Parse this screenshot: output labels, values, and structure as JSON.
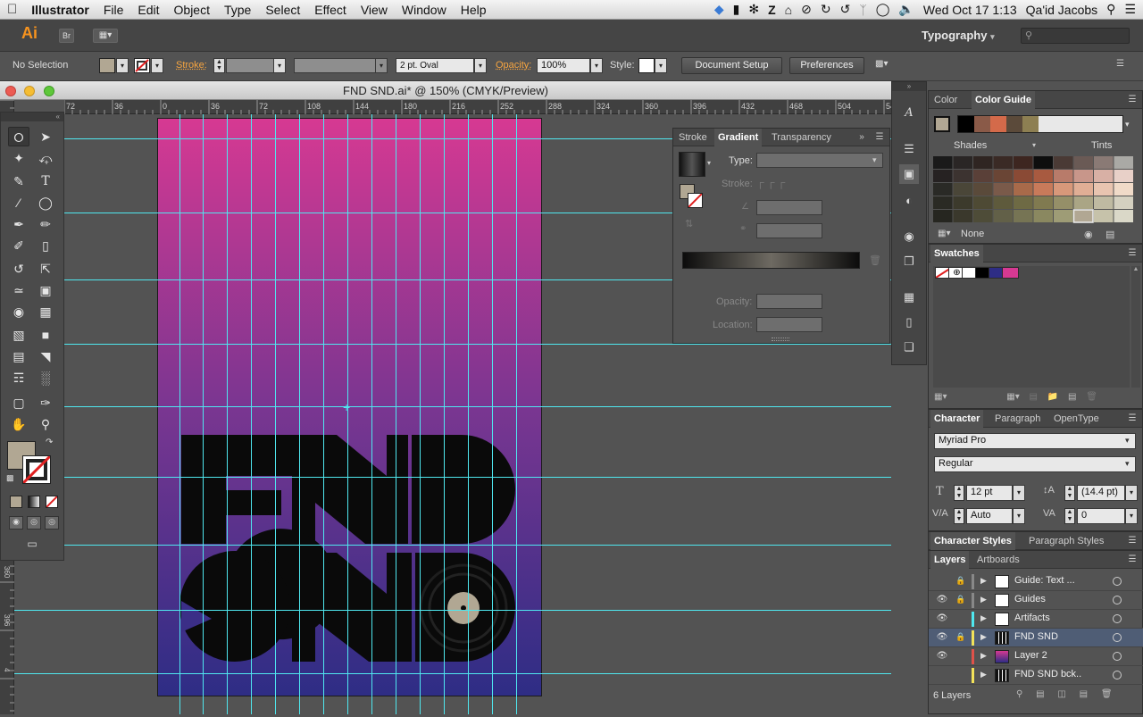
{
  "menubar": {
    "apple": "",
    "app_name": "Illustrator",
    "menus": [
      "File",
      "Edit",
      "Object",
      "Type",
      "Select",
      "Effect",
      "View",
      "Window",
      "Help"
    ],
    "clock": "Wed Oct 17  1:13",
    "user": "Qa'id Jacobs"
  },
  "appbar": {
    "logo": "Ai",
    "bridge": "Br",
    "workspace": "Typography",
    "search_placeholder": ""
  },
  "control": {
    "selection": "No Selection",
    "stroke_label": "Stroke:",
    "brush": "2 pt. Oval",
    "opacity_label": "Opacity:",
    "opacity_value": "100%",
    "style_label": "Style:",
    "doc_setup": "Document Setup",
    "preferences": "Preferences"
  },
  "document": {
    "title": "FND SND.ai* @ 150% (CMYK/Preview)",
    "ruler_h": [
      "72",
      "36",
      "0",
      "36",
      "72",
      "108",
      "144",
      "180",
      "216",
      "252",
      "288",
      "324",
      "360",
      "396",
      "432",
      "468",
      "504",
      "54"
    ],
    "ruler_v": [
      "360",
      "396",
      "4"
    ]
  },
  "gradient_panel": {
    "tabs": [
      "Stroke",
      "Gradient",
      "Transparency"
    ],
    "type_label": "Type:",
    "stroke_label": "Stroke:",
    "opacity_label": "Opacity:",
    "location_label": "Location:"
  },
  "color_panel": {
    "tabs": [
      "Color",
      "Color Guide"
    ],
    "shades": "Shades",
    "tints": "Tints",
    "none": "None",
    "colors": {
      "accent": "#b1a793",
      "orange": "#d46a4a",
      "pink": "#d63992"
    }
  },
  "swatches_panel": {
    "title": "Swatches"
  },
  "character_panel": {
    "tabs": [
      "Character",
      "Paragraph",
      "OpenType"
    ],
    "font": "Myriad Pro",
    "style": "Regular",
    "size": "12 pt",
    "leading": "(14.4 pt)",
    "kerning": "Auto",
    "tracking": "0"
  },
  "styles_tabs": [
    "Character Styles",
    "Paragraph Styles"
  ],
  "layers_panel": {
    "tabs": [
      "Layers",
      "Artboards"
    ],
    "layers": [
      {
        "name": "Guide: Text ...",
        "color": "#888888",
        "visible": false,
        "locked": true
      },
      {
        "name": "Guides",
        "color": "#888888",
        "visible": true,
        "locked": true
      },
      {
        "name": "Artifacts",
        "color": "#4fe7ef",
        "visible": true,
        "locked": false
      },
      {
        "name": "FND SND",
        "color": "#f2e25a",
        "visible": true,
        "locked": true
      },
      {
        "name": "Layer 2",
        "color": "#e0524a",
        "visible": true,
        "locked": false
      },
      {
        "name": "FND SND bck..",
        "color": "#f2e25a",
        "visible": false,
        "locked": false
      }
    ],
    "count": "6 Layers"
  }
}
